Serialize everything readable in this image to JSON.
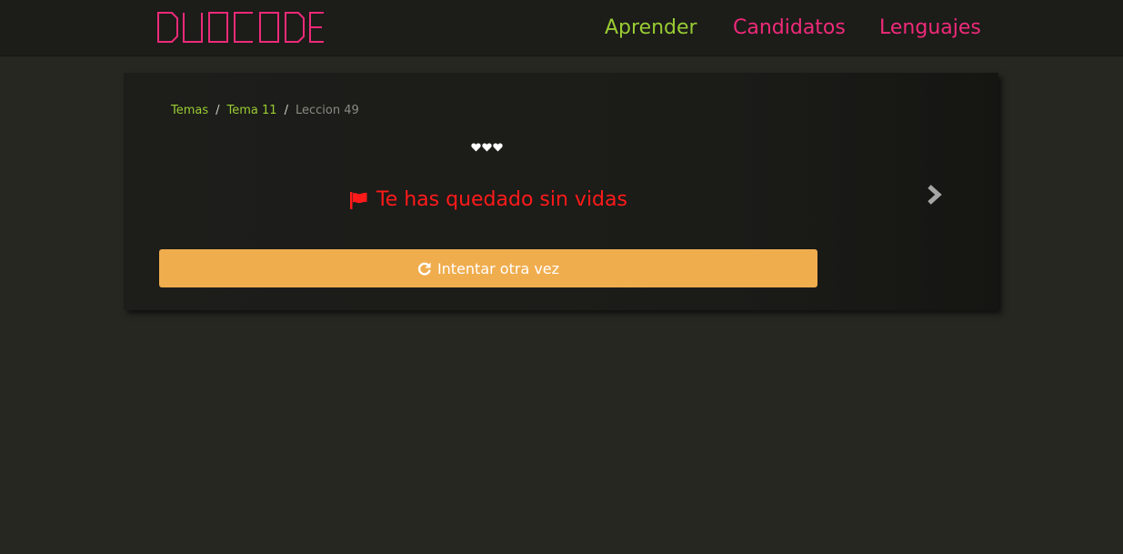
{
  "brand": {
    "logo_text": "DUOCODE",
    "logo_color": "#ef2a79"
  },
  "nav": {
    "items": [
      {
        "label": "Aprender",
        "color": "#99cc33"
      },
      {
        "label": "Candidatos",
        "color": "#ef2a79"
      },
      {
        "label": "Lenguajes",
        "color": "#ef2a79"
      }
    ]
  },
  "breadcrumb": {
    "items": [
      "Temas",
      "Tema 11"
    ],
    "separator": "/",
    "current": "Leccion 49"
  },
  "lives": {
    "count": 3,
    "icon": "heart-icon"
  },
  "status": {
    "message": "Te has quedado sin vidas",
    "icon": "flag-icon",
    "color": "#ff1a1a"
  },
  "next": {
    "icon": "chevron-right-icon"
  },
  "retry": {
    "label": "Intentar otra vez",
    "icon": "refresh-icon",
    "color": "#f0ad4e"
  }
}
